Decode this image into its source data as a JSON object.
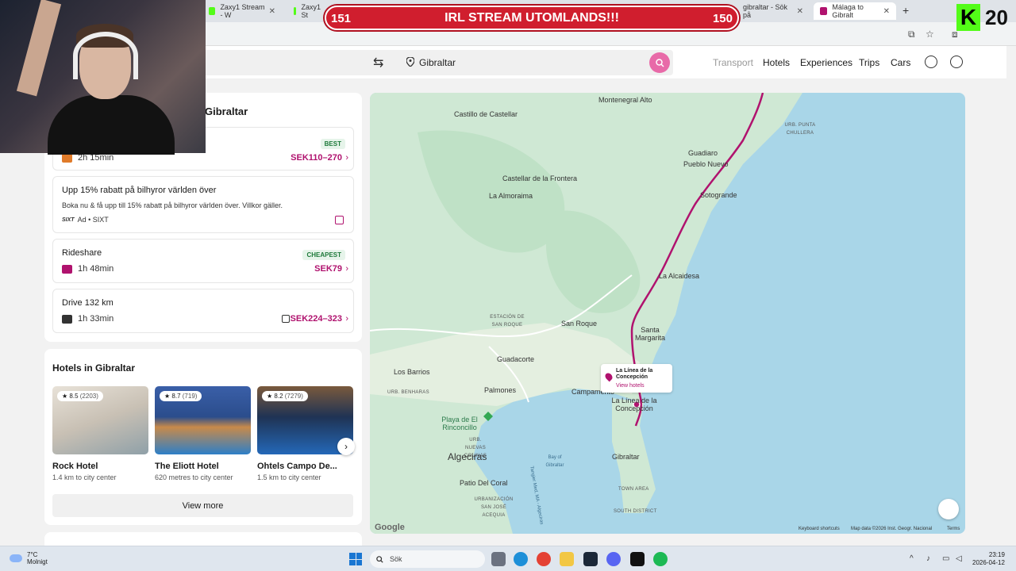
{
  "browser": {
    "tabs": [
      {
        "label": "Zaxy1 Stream - W",
        "favicon_color": "#53fc18"
      },
      {
        "label": "Zaxy1 St",
        "favicon_color": "#53fc18"
      },
      {
        "label": "gibraltar - Sök på",
        "favicon_color": ""
      },
      {
        "label": "Málaga to Gibralt",
        "favicon_color": "#b0126e"
      }
    ],
    "new_tab": "+"
  },
  "stream": {
    "banner_text": "IRL STREAM UTOMLANDS!!!",
    "banner_left": "151",
    "banner_right": "150",
    "kick_letter": "K",
    "kick_num": "20"
  },
  "header": {
    "destination": "Gibraltar",
    "nav": [
      "Transport",
      "Hotels",
      "Experiences",
      "Trips",
      "Cars"
    ]
  },
  "transport_panel": {
    "title_fragment": "Gibraltar",
    "best": {
      "badge": "BEST",
      "duration": "2h 15min",
      "price": "SEK110–270"
    },
    "ad": {
      "title": "Upp 15% rabatt på bilhyror världen över",
      "text": "Boka nu & få upp till 15% rabatt på bilhyror världen över. Villkor gäller.",
      "logo": "SIXT",
      "source": "Ad • SIXT"
    },
    "rideshare": {
      "title": "Rideshare",
      "badge": "CHEAPEST",
      "duration": "1h 48min",
      "price": "SEK79"
    },
    "drive": {
      "title": "Drive 132 km",
      "duration": "1h 33min",
      "price": "SEK224–323"
    }
  },
  "hotels": {
    "title": "Hotels in Gibraltar",
    "items": [
      {
        "name": "Rock Hotel",
        "rating": "8.5",
        "reviews": "(2203)",
        "distance": "1.4 km to city center",
        "image_color": "#c8c0b4"
      },
      {
        "name": "The Eliott Hotel",
        "rating": "8.7",
        "reviews": "(719)",
        "distance": "620 metres to city center",
        "image_color": "#2b4d8c"
      },
      {
        "name": "Ohtels Campo De...",
        "rating": "8.2",
        "reviews": "(7279)",
        "distance": "1.5 km to city center",
        "image_color": "#1f3354"
      }
    ],
    "view_more": "View more"
  },
  "map": {
    "labels": {
      "montenegral": "Montenegral Alto",
      "castillo": "Castillo de Castellar",
      "castellar": "Castellar de la Frontera",
      "almoraima": "La Almoraima",
      "punta": "URB. PUNTA CHULLERA",
      "guadiaro": "Guadiaro",
      "pueblo_nuevo": "Pueblo Nuevo",
      "sotogrande": "Sotogrande",
      "alcaidesa": "La Alcaidesa",
      "estacion": "ESTACIÓN DE SAN ROQUE",
      "san_roque": "San Roque",
      "santa_margarita": "Santa Margarita",
      "guadacorte": "Guadacorte",
      "los_barrios": "Los Barrios",
      "benharas": "URB. BENHARAS",
      "palmones": "Palmones",
      "campamento": "Campamento",
      "linea": "La Línea de la Concepción",
      "playa": "Playa de El Rinconcillo",
      "nuevas": "URB. NUEVAS COLINAS",
      "algeciras": "Algeciras",
      "bay": "Bay of Gibraltar",
      "gibraltar": "Gibraltar",
      "patio": "Patio Del Coral",
      "urb_aguada": "URBANIZACIÓN SAN JOSÉ ACEQUIA",
      "town_area": "TOWN AREA",
      "south": "SOUTH DISTRICT",
      "tangier": "Tangier Med, MA - Algeciras"
    },
    "popup": {
      "name": "La Línea de la Concepción",
      "link": "View hotels"
    },
    "google": "Google",
    "footer": [
      "Keyboard shortcuts",
      "Map data ©2026 Inst. Geogr. Nacional",
      "Terms"
    ]
  },
  "taskbar": {
    "weather_temp": "7°C",
    "weather_desc": "Molnigt",
    "search": "Sök",
    "time": "23:19",
    "date": "2026-04-12"
  }
}
